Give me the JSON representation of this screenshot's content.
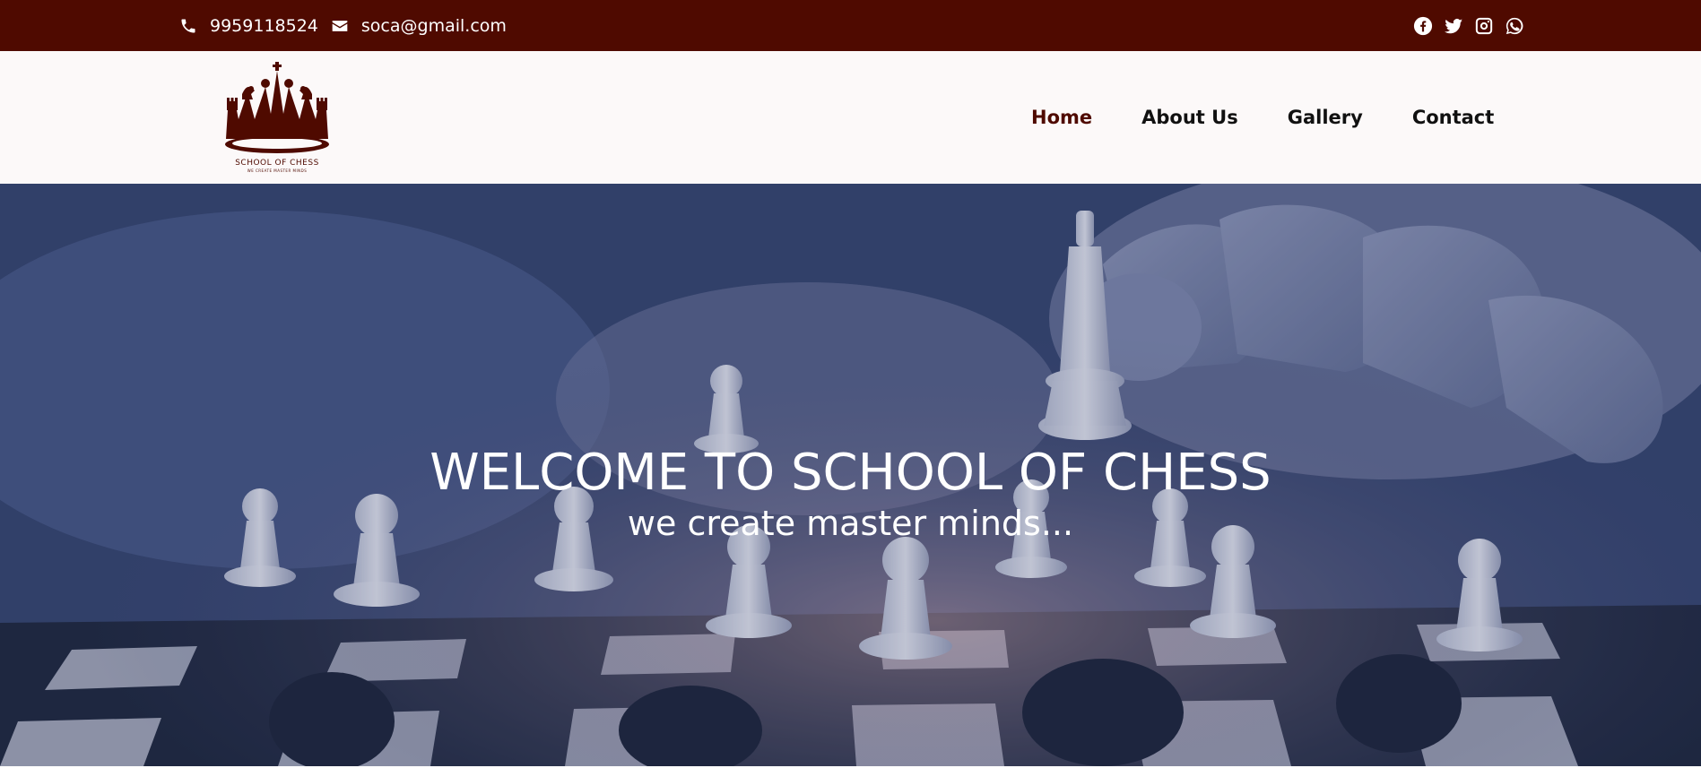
{
  "topbar": {
    "phone": "9959118524",
    "email": "soca@gmail.com",
    "social": [
      "facebook-icon",
      "twitter-icon",
      "instagram-icon",
      "whatsapp-icon"
    ],
    "background": "#4f0a00"
  },
  "header": {
    "logo": {
      "title": "SCHOOL OF CHESS",
      "tagline": "WE CREATE MASTER MINDS"
    },
    "nav": [
      {
        "label": "Home",
        "active": true
      },
      {
        "label": "About Us",
        "active": false
      },
      {
        "label": "Gallery",
        "active": false
      },
      {
        "label": "Contact",
        "active": false
      }
    ]
  },
  "hero": {
    "title": "WELCOME TO SCHOOL OF CHESS",
    "subtitle": "we create master minds..."
  },
  "colors": {
    "brand": "#4f0a00",
    "nav_active": "#4f0a00",
    "nav_text": "#111111",
    "hero_overlay": "#34466f"
  }
}
